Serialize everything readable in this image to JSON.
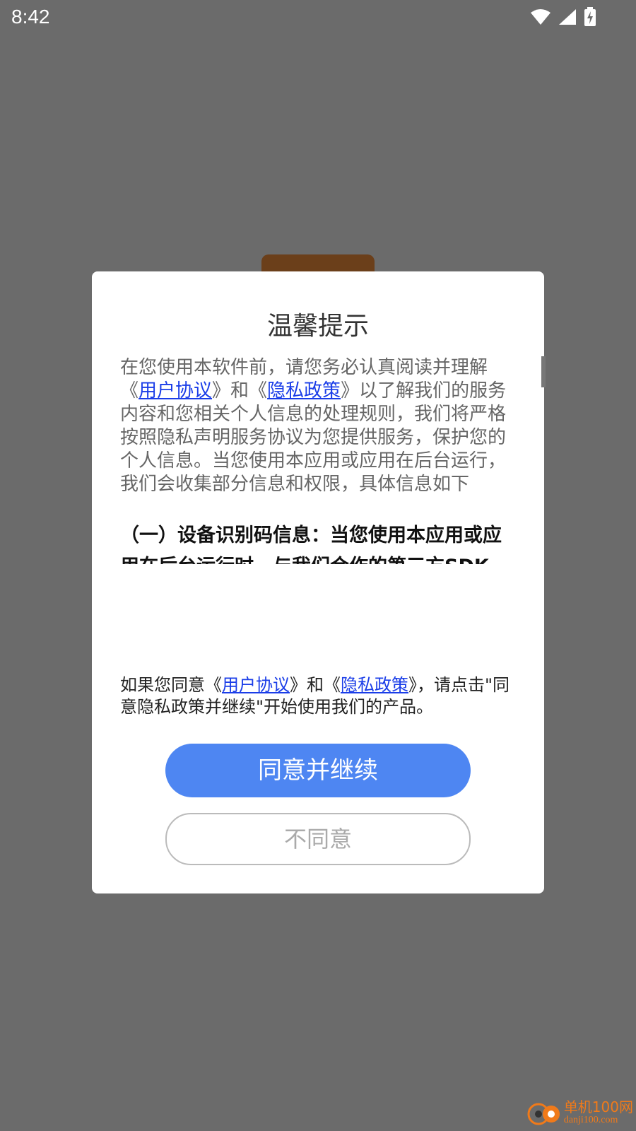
{
  "status_bar": {
    "time": "8:42",
    "icons": [
      "wifi-icon",
      "cellular-signal-icon",
      "battery-charging-icon"
    ]
  },
  "dialog": {
    "title": "温馨提示",
    "intro": {
      "prefix": "在您使用本软件前，请您务必认真阅读并理解《",
      "link1": "用户协议",
      "middle": "》和《",
      "link2": "隐私政策",
      "suffix": "》以了解我们的服务内容和您相关个人信息的处理规则，我们将严格按照隐私声明服务协议为您提供服务，保护您的个人信息。当您使用本应用或应用在后台运行，我们会收集部分信息和权限，具体信息如下"
    },
    "section1": "（一）设备识别码信息：当您使用本应用或应用在后台运行时，与我们合作的第三方SDK会“后台”或“静默”状态下收集您使用设备的相关信息，收集内容包括但不限",
    "footer": {
      "prefix": "如果您同意《",
      "link1": "用户协议",
      "middle": "》和《",
      "link2": "隐私政策",
      "suffix": "》，请点击\"同意隐私政策并继续\"开始使用我们的产品。"
    },
    "agree_label": "同意并继续",
    "disagree_label": "不同意"
  },
  "watermark": {
    "name": "单机100网",
    "url": "danji100.com"
  },
  "colors": {
    "overlay": "#6b6b6b",
    "agree_button": "#4e86f2",
    "link": "#1a3de8",
    "watermark": "#f07a1a"
  }
}
